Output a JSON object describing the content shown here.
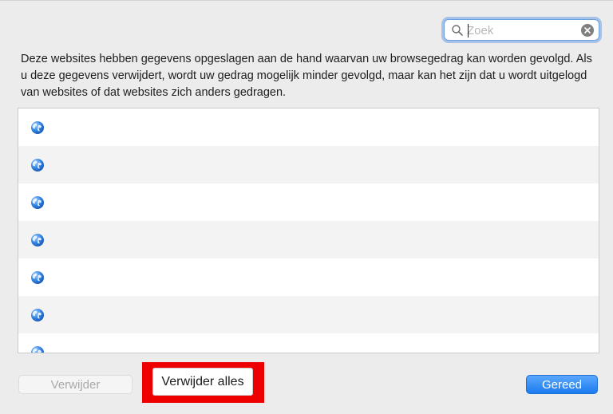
{
  "search": {
    "placeholder": "Zoek",
    "value": ""
  },
  "description": "Deze websites hebben gegevens opgeslagen aan de hand waarvan uw browsegedrag kan worden gevolgd. Als u deze gegevens verwijdert, wordt uw gedrag mogelijk minder gevolgd, maar kan het zijn dat u wordt uitgelogd van websites of dat websites zich anders gedragen.",
  "website_list": {
    "icon": "globe-icon",
    "rows": [
      "",
      "",
      "",
      "",
      "",
      "",
      ""
    ]
  },
  "buttons": {
    "remove": "Verwijder",
    "remove_all": "Verwijder alles",
    "done": "Gereed"
  },
  "colors": {
    "accent": "#1b7bf0",
    "highlight": "#ee0000",
    "window_bg": "#ececec"
  }
}
